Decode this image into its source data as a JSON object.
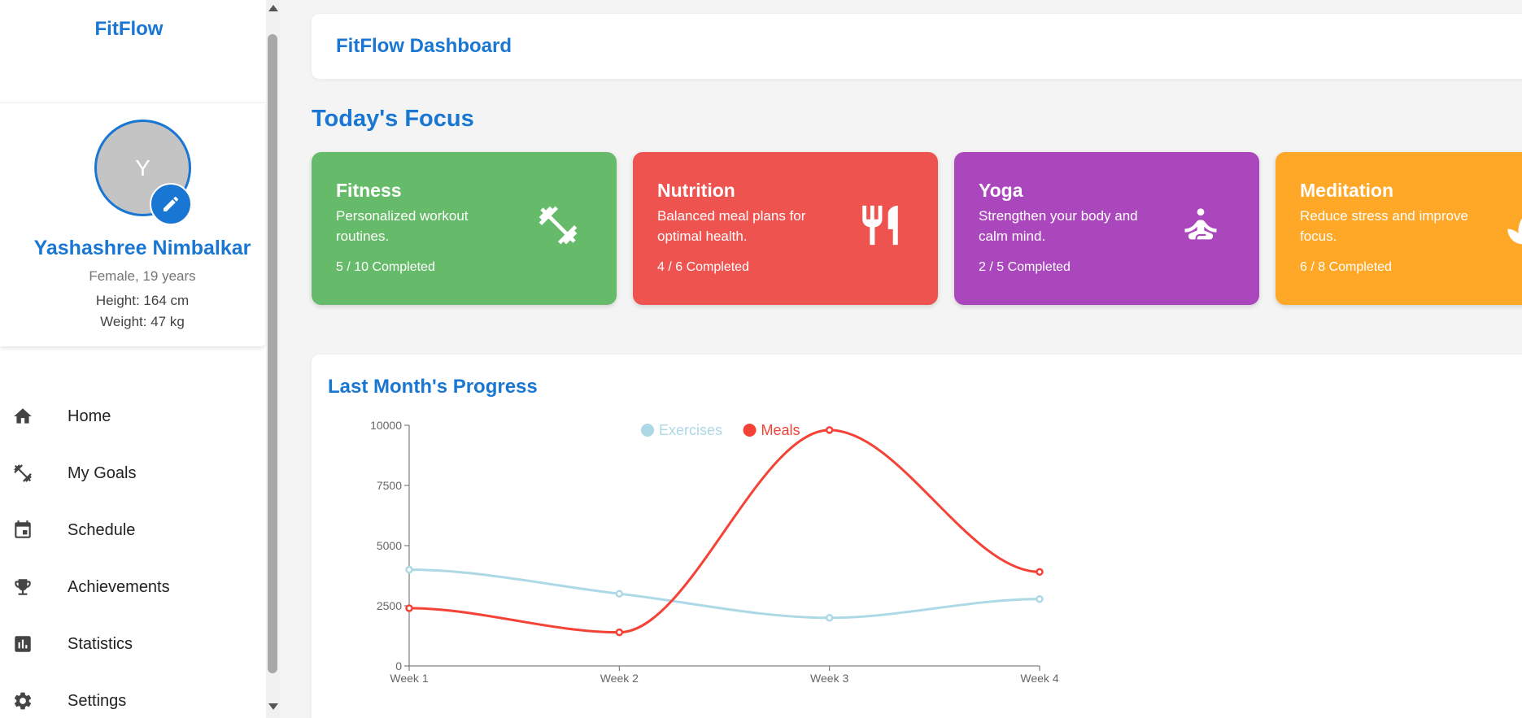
{
  "sidebar": {
    "brand": "FitFlow",
    "profile": {
      "initial": "Y",
      "name": "Yashashree Nimbalkar",
      "gender_age": "Female, 19 years",
      "height": "Height: 164 cm",
      "weight": "Weight: 47 kg"
    },
    "nav": [
      {
        "label": "Home",
        "icon": "home-icon"
      },
      {
        "label": "My Goals",
        "icon": "dumbbell-icon"
      },
      {
        "label": "Schedule",
        "icon": "calendar-icon"
      },
      {
        "label": "Achievements",
        "icon": "trophy-icon"
      },
      {
        "label": "Statistics",
        "icon": "bar-chart-icon"
      },
      {
        "label": "Settings",
        "icon": "gear-icon"
      }
    ]
  },
  "header": {
    "title": "FitFlow Dashboard"
  },
  "focus": {
    "title": "Today's Focus",
    "cards": [
      {
        "title": "Fitness",
        "desc": "Personalized workout routines.",
        "count": "5 / 10 Completed",
        "color": "#66bb6a",
        "icon": "dumbbell-icon"
      },
      {
        "title": "Nutrition",
        "desc": "Balanced meal plans for optimal health.",
        "count": "4 / 6 Completed",
        "color": "#ef5350",
        "icon": "fork-knife-icon"
      },
      {
        "title": "Yoga",
        "desc": "Strengthen your body and calm mind.",
        "count": "2 / 5 Completed",
        "color": "#ab47bc",
        "icon": "meditation-icon"
      },
      {
        "title": "Meditation",
        "desc": "Reduce stress and improve focus.",
        "count": "6 / 8 Completed",
        "color": "#ffa726",
        "icon": "leaf-icon"
      }
    ]
  },
  "progress": {
    "title": "Last Month's Progress"
  },
  "chart_data": {
    "type": "line",
    "title": "",
    "xlabel": "",
    "ylabel": "",
    "categories": [
      "Week 1",
      "Week 2",
      "Week 3",
      "Week 4"
    ],
    "ylim": [
      0,
      10000
    ],
    "yticks": [
      0,
      2500,
      5000,
      7500,
      10000
    ],
    "legend": "top-center",
    "series": [
      {
        "name": "Exercises",
        "values": [
          4000,
          3000,
          2000,
          2780
        ],
        "color": "#add8e6"
      },
      {
        "name": "Meals",
        "values": [
          2400,
          1398,
          9800,
          3908
        ],
        "color": "#f44336"
      }
    ]
  }
}
